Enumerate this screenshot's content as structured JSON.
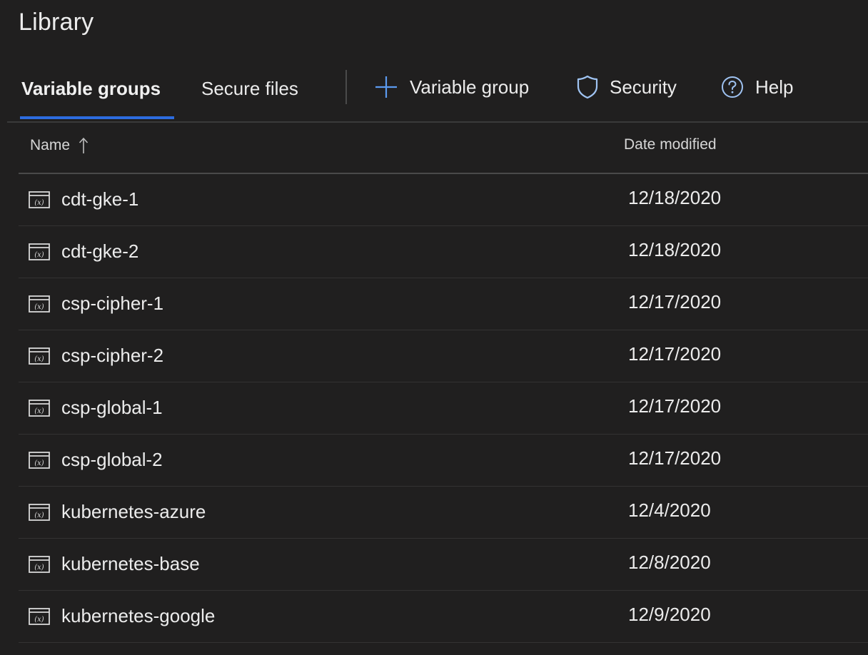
{
  "page": {
    "title": "Library"
  },
  "tabs": [
    {
      "label": "Variable groups",
      "active": true
    },
    {
      "label": "Secure files",
      "active": false
    }
  ],
  "commands": {
    "add_variable_group": {
      "label": "Variable group",
      "icon": "plus-icon"
    },
    "security": {
      "label": "Security",
      "icon": "shield-icon"
    },
    "help": {
      "label": "Help",
      "icon": "help-circle-icon"
    }
  },
  "table": {
    "columns": {
      "name": "Name",
      "date_modified": "Date modified"
    },
    "sort": {
      "column": "name",
      "direction": "ascending",
      "icon": "arrow-up-icon"
    },
    "rows": [
      {
        "name": "cdt-gke-1",
        "date_modified": "12/18/2020",
        "icon": "variable-group-icon"
      },
      {
        "name": "cdt-gke-2",
        "date_modified": "12/18/2020",
        "icon": "variable-group-icon"
      },
      {
        "name": "csp-cipher-1",
        "date_modified": "12/17/2020",
        "icon": "variable-group-icon"
      },
      {
        "name": "csp-cipher-2",
        "date_modified": "12/17/2020",
        "icon": "variable-group-icon"
      },
      {
        "name": "csp-global-1",
        "date_modified": "12/17/2020",
        "icon": "variable-group-icon"
      },
      {
        "name": "csp-global-2",
        "date_modified": "12/17/2020",
        "icon": "variable-group-icon"
      },
      {
        "name": "kubernetes-azure",
        "date_modified": "12/4/2020",
        "icon": "variable-group-icon"
      },
      {
        "name": "kubernetes-base",
        "date_modified": "12/8/2020",
        "icon": "variable-group-icon"
      },
      {
        "name": "kubernetes-google",
        "date_modified": "12/9/2020",
        "icon": "variable-group-icon"
      }
    ]
  },
  "colors": {
    "background": "#201f1f",
    "accent": "#2d6cdf",
    "text": "#ececec"
  }
}
